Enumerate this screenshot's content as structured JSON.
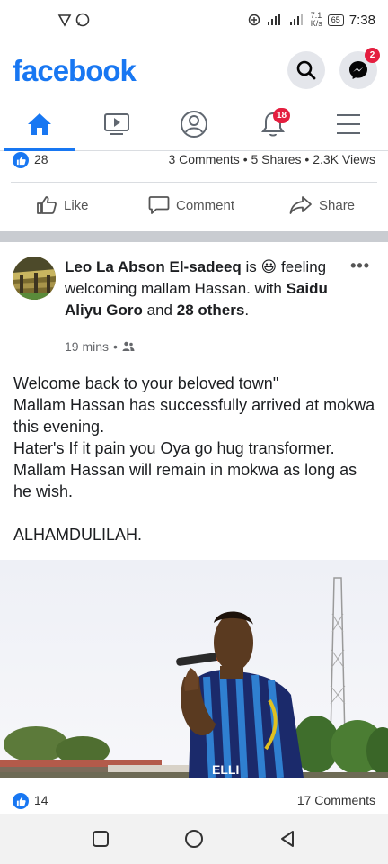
{
  "status_bar": {
    "time": "7:38",
    "net_speed_value": "7.1",
    "net_speed_unit": "K/s",
    "battery": "65"
  },
  "header": {
    "logo": "facebook",
    "messenger_badge": "2"
  },
  "tabs": {
    "notifications_badge": "18"
  },
  "prev_post": {
    "like_count": "28",
    "stats": "3 Comments • 5 Shares • 2.3K Views",
    "actions": {
      "like": "Like",
      "comment": "Comment",
      "share": "Share"
    }
  },
  "post": {
    "author": "Leo La Abson El-sadeeq",
    "is_text": "is",
    "emoji": "😃",
    "feeling": "feeling welcoming mallam Hassan.",
    "with_text": "with",
    "tagged": "Saidu Aliyu Goro",
    "and_text": "and",
    "others": "28 others",
    "time": "19 mins",
    "body_lines": [
      "Welcome back to your beloved town\"",
      "Mallam Hassan has successfully arrived at mokwa this evening.",
      "Hater's If it pain you Oya go hug transformer.",
      "Mallam Hassan will remain in mokwa as long as he wish."
    ],
    "closing": "ALHAMDULILAH.",
    "jersey_text": "ELLI",
    "like_count": "14",
    "comments": "17 Comments"
  },
  "icons": {
    "status_left": [
      "vpn-circle-icon",
      "whatsapp-icon"
    ],
    "status_right": [
      "data-saver-icon",
      "signal-icon",
      "signal-icon",
      "battery-icon"
    ],
    "tabs": [
      "home-icon",
      "video-icon",
      "profile-icon",
      "bell-icon",
      "menu-icon"
    ],
    "nav": [
      "recent-apps-icon",
      "home-circle-icon",
      "back-triangle-icon"
    ]
  },
  "colors": {
    "brand": "#1877f2",
    "badge": "#e41e3f",
    "secondary_text": "#65676b"
  }
}
